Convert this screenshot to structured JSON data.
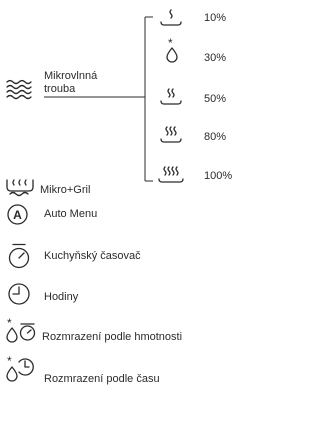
{
  "microwave": {
    "label_line1": "Mikrovlnná",
    "label_line2": "trouba",
    "levels": [
      {
        "icon": "microwave-power-1-icon",
        "percent": "10%"
      },
      {
        "icon": "droplet-snowflake-icon",
        "percent": "30%"
      },
      {
        "icon": "microwave-power-2-icon",
        "percent": "50%"
      },
      {
        "icon": "microwave-power-3-icon",
        "percent": "80%"
      },
      {
        "icon": "microwave-power-4-icon",
        "percent": "100%"
      }
    ]
  },
  "menu": [
    {
      "icon": "micro-grill-icon",
      "label": "Mikro+Gril"
    },
    {
      "icon": "auto-menu-icon",
      "label": "Auto Menu",
      "icon_letter": "A"
    },
    {
      "icon": "kitchen-timer-icon",
      "label": "Kuchyňský časovač"
    },
    {
      "icon": "clock-icon",
      "label": "Hodiny"
    },
    {
      "icon": "defrost-by-weight-icon",
      "label": "Rozmrazení podle hmotnosti"
    },
    {
      "icon": "defrost-by-time-icon",
      "label": "Rozmrazení podle času"
    }
  ]
}
